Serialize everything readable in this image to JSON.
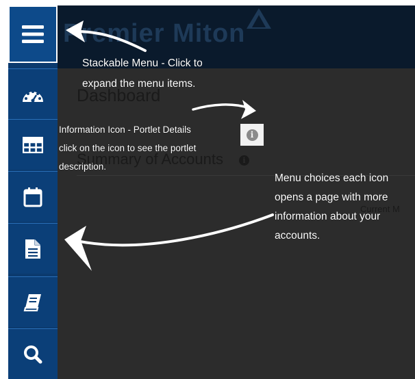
{
  "header": {
    "brand": "Premier Miton"
  },
  "main": {
    "page_title": "Dashboard",
    "portlet_title": "Summary of Accounts",
    "column_header": "Current M"
  },
  "sidebar": {
    "menu_icon": "hamburger-menu-icon",
    "items": [
      {
        "icon": "dashboard-gauge-icon"
      },
      {
        "icon": "table-grid-icon"
      },
      {
        "icon": "calendar-icon"
      },
      {
        "icon": "document-icon"
      },
      {
        "icon": "book-icon"
      },
      {
        "icon": "search-icon"
      }
    ]
  },
  "annotations": {
    "stackable_menu": {
      "line1": "Stackable Menu - Click to",
      "line2": "expand the menu items."
    },
    "information_icon": {
      "line1": "Information Icon - Portlet Details",
      "line2": "click on the icon to see the portlet",
      "line3": "description."
    },
    "menu_choices": {
      "line1": "Menu choices each icon",
      "line2": "opens a page with more",
      "line3": "information about your",
      "line4": "accounts."
    }
  },
  "colors": {
    "sidebar": "#0b3f78",
    "sidebar_active": "#0d4a8a",
    "header": "#0a1a2c",
    "overlay": "#2c2c2c",
    "annotation_text": "#ffffff"
  }
}
